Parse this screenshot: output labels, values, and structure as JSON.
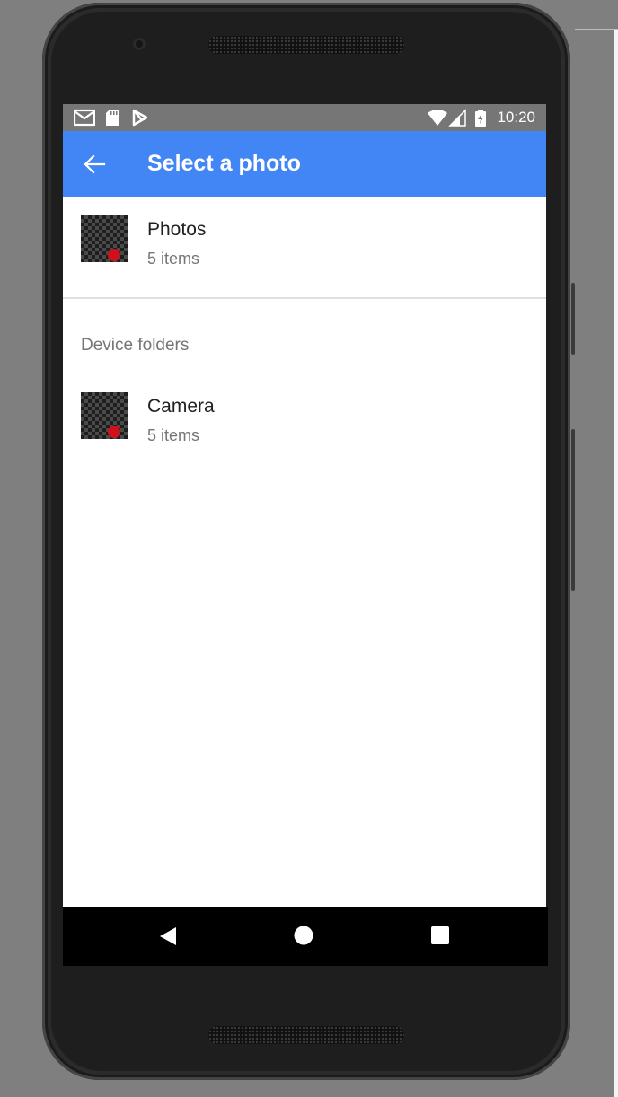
{
  "status_bar": {
    "time": "10:20",
    "icons_left": [
      "gmail-icon",
      "sd-card-icon",
      "play-store-icon"
    ],
    "icons_right": [
      "wifi-icon",
      "signal-icon",
      "battery-icon"
    ]
  },
  "app_bar": {
    "title": "Select a photo",
    "back_icon": "arrow-back-icon",
    "color": "#4285f4"
  },
  "albums": [
    {
      "title": "Photos",
      "subtitle": "5 items"
    }
  ],
  "device_folders": {
    "header": "Device folders",
    "items": [
      {
        "title": "Camera",
        "subtitle": "5 items"
      }
    ]
  },
  "nav_bar": {
    "buttons": [
      "back-triangle-icon",
      "home-circle-icon",
      "recents-square-icon"
    ]
  }
}
